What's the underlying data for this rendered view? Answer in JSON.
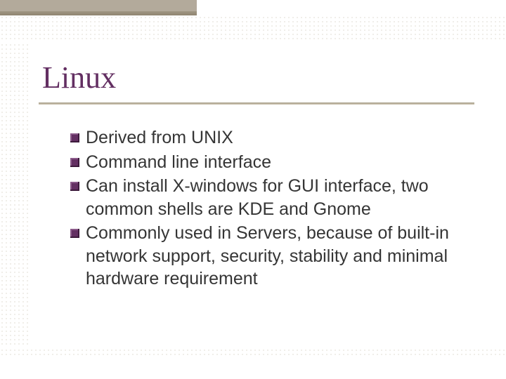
{
  "slide": {
    "title": "Linux",
    "bullets": [
      "Derived from UNIX",
      "Command line interface",
      "Can install X-windows for GUI interface, two common shells are KDE and Gnome",
      "Commonly used in Servers, because of built-in network support, security, stability and minimal hardware requirement"
    ]
  }
}
